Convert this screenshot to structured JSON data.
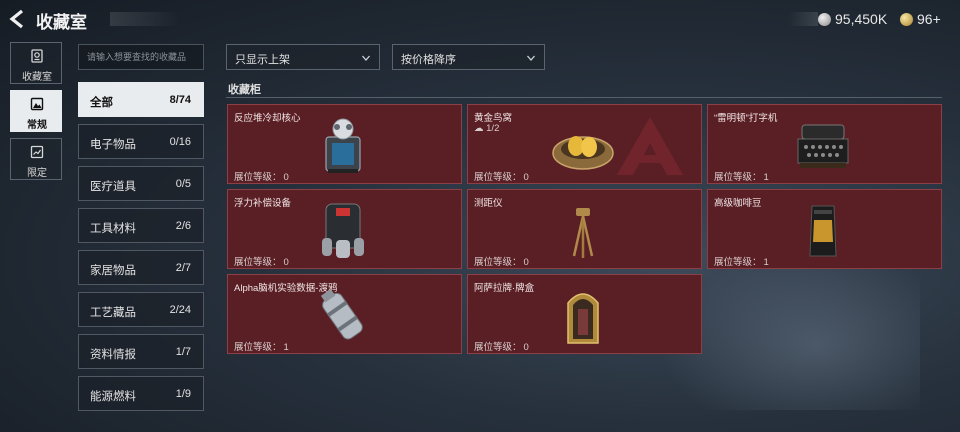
{
  "header": {
    "title": "收藏室",
    "currency_silver": "95,450K",
    "currency_gold": "96+"
  },
  "rail": [
    {
      "label": "收藏室",
      "icon": "trophy-icon",
      "active": false
    },
    {
      "label": "常规",
      "icon": "image-icon",
      "active": true
    },
    {
      "label": "限定",
      "icon": "limited-icon",
      "active": false
    }
  ],
  "search": {
    "placeholder": "请输入想要查找的收藏品"
  },
  "filters": {
    "shelf": "只显示上架",
    "sort": "按价格降序"
  },
  "categories": [
    {
      "name": "全部",
      "count": "8/74"
    },
    {
      "name": "电子物品",
      "count": "0/16"
    },
    {
      "name": "医疗道具",
      "count": "0/5"
    },
    {
      "name": "工具材料",
      "count": "2/6"
    },
    {
      "name": "家居物品",
      "count": "2/7"
    },
    {
      "name": "工艺藏品",
      "count": "2/24"
    },
    {
      "name": "资料情报",
      "count": "1/7"
    },
    {
      "name": "能源燃料",
      "count": "1/9"
    }
  ],
  "section_title": "收藏柜",
  "level_label": "展位等级：",
  "items": [
    {
      "name": "反应堆冷却核心",
      "sub": "",
      "level": "0",
      "icon": "reactor-core-icon"
    },
    {
      "name": "黄金鸟窝",
      "sub": "1/2",
      "level": "0",
      "icon": "golden-nest-icon"
    },
    {
      "name": "“雷明顿”打字机",
      "sub": "",
      "level": "1",
      "icon": "typewriter-icon"
    },
    {
      "name": "浮力补偿设备",
      "sub": "",
      "level": "0",
      "icon": "buoyancy-device-icon"
    },
    {
      "name": "测距仪",
      "sub": "",
      "level": "0",
      "icon": "rangefinder-icon"
    },
    {
      "name": "高级咖啡豆",
      "sub": "",
      "level": "1",
      "icon": "coffee-bag-icon"
    },
    {
      "name": "Alpha脑机实验数据-渡鸦",
      "sub": "",
      "level": "1",
      "icon": "data-canister-icon"
    },
    {
      "name": "阿萨拉牌·牌盒",
      "sub": "",
      "level": "0",
      "icon": "card-box-icon"
    }
  ]
}
